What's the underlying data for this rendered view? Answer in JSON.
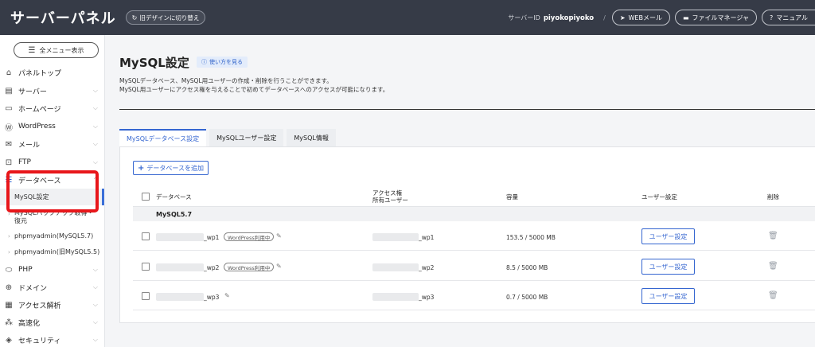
{
  "header": {
    "brand": "サーバーパネル",
    "old_design": "旧デザインに切り替え",
    "server_id_label": "サーバーID",
    "server_id_value": "piyokopiyoko",
    "separator": "/",
    "links": [
      {
        "icon": "paper-plane-icon",
        "glyph": "➤",
        "label": "WEBメール"
      },
      {
        "icon": "folder-icon",
        "glyph": "▬",
        "label": "ファイルマネージャ"
      },
      {
        "icon": "help-icon",
        "glyph": "?",
        "label": "マニュアル"
      }
    ]
  },
  "sidebar": {
    "menu_button": "全メニュー表示",
    "items": [
      {
        "icon": "home-icon",
        "glyph": "⌂",
        "label": "パネルトップ"
      },
      {
        "icon": "server-icon",
        "glyph": "▤",
        "label": "サーバー"
      },
      {
        "icon": "monitor-icon",
        "glyph": "▭",
        "label": "ホームページ"
      },
      {
        "icon": "wordpress-icon",
        "glyph": "Ⓦ",
        "label": "WordPress"
      },
      {
        "icon": "mail-icon",
        "glyph": "✉",
        "label": "メール"
      },
      {
        "icon": "ftp-icon",
        "glyph": "⊡",
        "label": "FTP"
      },
      {
        "icon": "database-icon",
        "glyph": "☰",
        "label": "データベース"
      }
    ],
    "sub_items": [
      {
        "label": "MySQL設定"
      },
      {
        "label1": "MySQLバックアップ取得・",
        "label2": "復元"
      },
      {
        "label": "phpmyadmin(MySQL5.7)"
      },
      {
        "label": "phpmyadmin(旧MySQL5.5)"
      }
    ],
    "bottom_items": [
      {
        "icon": "php-icon",
        "glyph": "⬭",
        "label": "PHP"
      },
      {
        "icon": "globe-icon",
        "glyph": "⊕",
        "label": "ドメイン"
      },
      {
        "icon": "analytics-icon",
        "glyph": "▦",
        "label": "アクセス解析"
      },
      {
        "icon": "speed-icon",
        "glyph": "⁂",
        "label": "高速化"
      },
      {
        "icon": "shield-icon",
        "glyph": "◈",
        "label": "セキュリティ"
      }
    ]
  },
  "main": {
    "title": "MySQL設定",
    "howto": "使い方を見る",
    "description1": "MySQLデータベース、MySQL用ユーザーの作成・削除を行うことができます。",
    "description2": "MySQL用ユーザーにアクセス権を与えることで初めてデータベースへのアクセスが可能になります。",
    "tabs": [
      "MySQLデータベース設定",
      "MySQLユーザー設定",
      "MySQL情報"
    ],
    "add_button": "データベースを追加",
    "table": {
      "col_db": "データベース",
      "col_access1": "アクセス権",
      "col_access2": "所有ユーザー",
      "col_size": "容量",
      "col_user": "ユーザー設定",
      "col_delete": "削除",
      "group": "MySQL5.7",
      "rows": [
        {
          "db_suffix": "_wp1",
          "badge": "WordPress利用中",
          "user_suffix": "_wp1",
          "size": "153.5 / 5000 MB",
          "button": "ユーザー設定"
        },
        {
          "db_suffix": "_wp2",
          "badge": "WordPress利用中",
          "user_suffix": "_wp2",
          "size": "8.5 / 5000 MB",
          "button": "ユーザー設定"
        },
        {
          "db_suffix": "_wp3",
          "badge": "",
          "user_suffix": "_wp3",
          "size": "0.7 / 5000 MB",
          "button": "ユーザー設定"
        }
      ]
    }
  }
}
